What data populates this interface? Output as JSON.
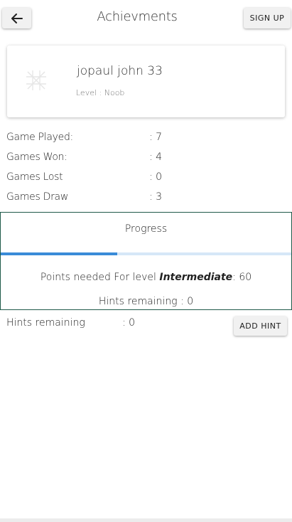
{
  "header": {
    "title": "Achievments",
    "signup_label": "SIGN UP",
    "back_icon": "arrow-left-icon"
  },
  "profile": {
    "name": "jopaul john 33",
    "level_text": "Level : Noob",
    "logo_icon": "tic-tac-toe-icon"
  },
  "stats": [
    {
      "label": "Game Played:",
      "value": ": 7"
    },
    {
      "label": "Games Won:",
      "value": ": 4"
    },
    {
      "label": "Games Lost",
      "value": ": 0"
    },
    {
      "label": "Games Draw",
      "value": ": 3"
    }
  ],
  "progress": {
    "title": "Progress",
    "fill_fraction": 0.4,
    "points_prefix": "Points needed For level ",
    "points_level": "Intermediate",
    "points_suffix": ": 60",
    "hints_text": "Hints remaining : 0"
  },
  "hints": {
    "label": "Hints remaining",
    "value": ": 0",
    "add_label": "ADD HINT"
  },
  "colors": {
    "accent": "#3a8bd8",
    "track": "#d6e7f7",
    "border": "#1f5a4a"
  }
}
